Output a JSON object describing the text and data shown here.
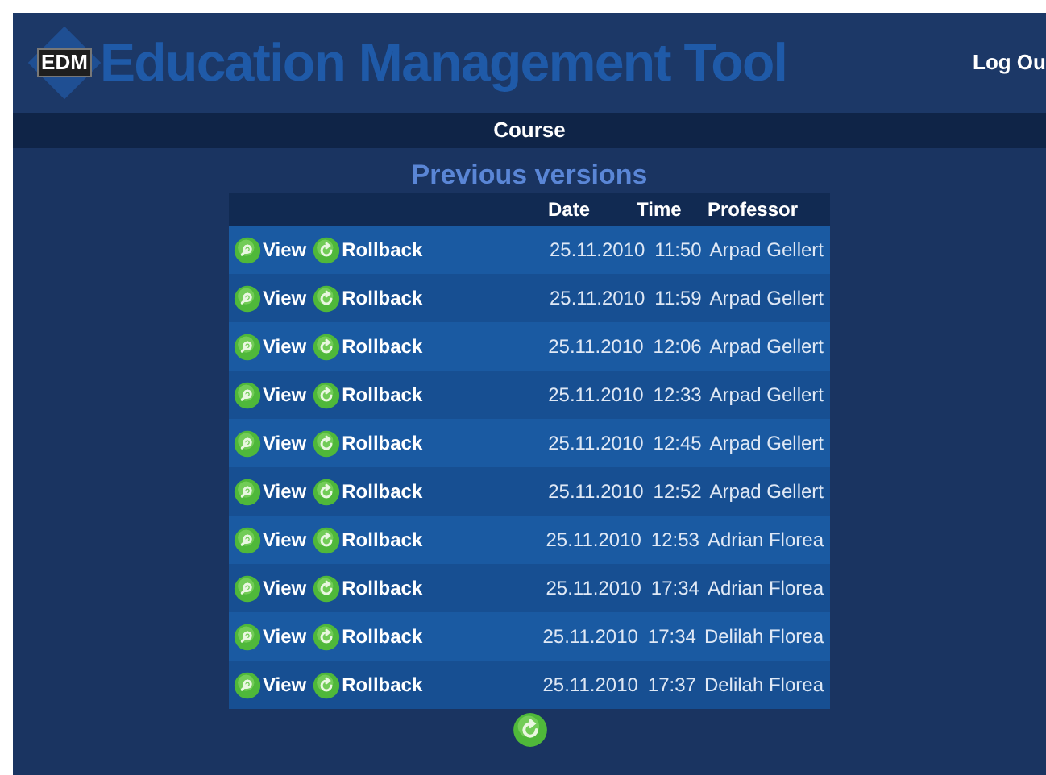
{
  "header": {
    "logo_badge": "EDM",
    "title": "Education Management Tool",
    "logout": "Log Ou"
  },
  "nav": {
    "label": "Course"
  },
  "section_title": "Previous versions",
  "table": {
    "columns": [
      "Date",
      "Time",
      "Professor"
    ],
    "rows": [
      {
        "view": "View",
        "rollback": "Rollback",
        "date": "25.11.2010",
        "time": "11:50",
        "professor": "Arpad Gellert"
      },
      {
        "view": "View",
        "rollback": "Rollback",
        "date": "25.11.2010",
        "time": "11:59",
        "professor": "Arpad Gellert"
      },
      {
        "view": "View",
        "rollback": "Rollback",
        "date": "25.11.2010",
        "time": "12:06",
        "professor": "Arpad Gellert"
      },
      {
        "view": "View",
        "rollback": "Rollback",
        "date": "25.11.2010",
        "time": "12:33",
        "professor": "Arpad Gellert"
      },
      {
        "view": "View",
        "rollback": "Rollback",
        "date": "25.11.2010",
        "time": "12:45",
        "professor": "Arpad Gellert"
      },
      {
        "view": "View",
        "rollback": "Rollback",
        "date": "25.11.2010",
        "time": "12:52",
        "professor": "Arpad Gellert"
      },
      {
        "view": "View",
        "rollback": "Rollback",
        "date": "25.11.2010",
        "time": "12:53",
        "professor": "Adrian Florea"
      },
      {
        "view": "View",
        "rollback": "Rollback",
        "date": "25.11.2010",
        "time": "17:34",
        "professor": "Adrian Florea"
      },
      {
        "view": "View",
        "rollback": "Rollback",
        "date": "25.11.2010",
        "time": "17:34",
        "professor": "Delilah Florea"
      },
      {
        "view": "View",
        "rollback": "Rollback",
        "date": "25.11.2010",
        "time": "17:37",
        "professor": "Delilah Florea"
      }
    ]
  }
}
